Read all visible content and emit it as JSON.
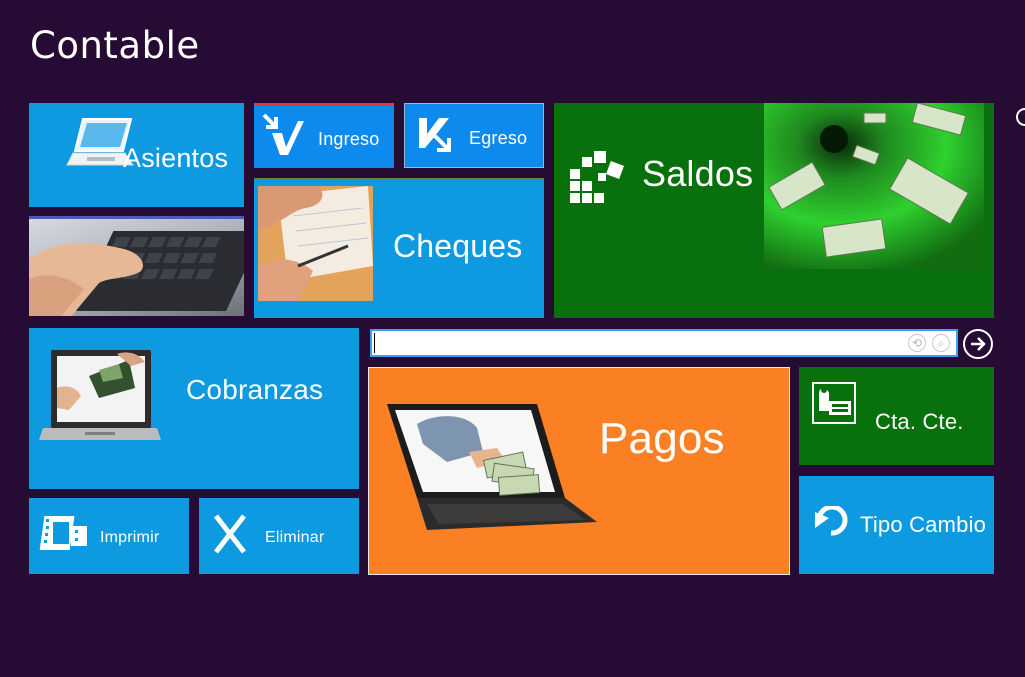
{
  "app": {
    "title": "Contable"
  },
  "tiles": {
    "asientos": "Asientos",
    "ingreso": "Ingreso",
    "egreso": "Egreso",
    "saldos": "Saldos",
    "cheques": "Cheques",
    "cobranzas": "Cobranzas",
    "pagos": "Pagos",
    "cta_cte": "Cta. Cte.",
    "tipo_cambio": "Tipo Cambio",
    "imprimir": "Imprimir",
    "eliminar": "Eliminar"
  },
  "search": {
    "value": "",
    "placeholder": ""
  },
  "colors": {
    "background": "#260b35",
    "tile_blue": "#0e9ae0",
    "tile_green": "#08700d",
    "tile_orange": "#fb8024",
    "button_blue": "#0d8aee"
  },
  "icons": [
    "laptop-icon",
    "ingreso-arrow-icon",
    "egreso-arrow-icon",
    "blocks-icon",
    "printer-icon",
    "undo-arrow-icon",
    "film-icon",
    "x-icon",
    "arrow-right-icon",
    "clear-icon",
    "search-icon"
  ]
}
